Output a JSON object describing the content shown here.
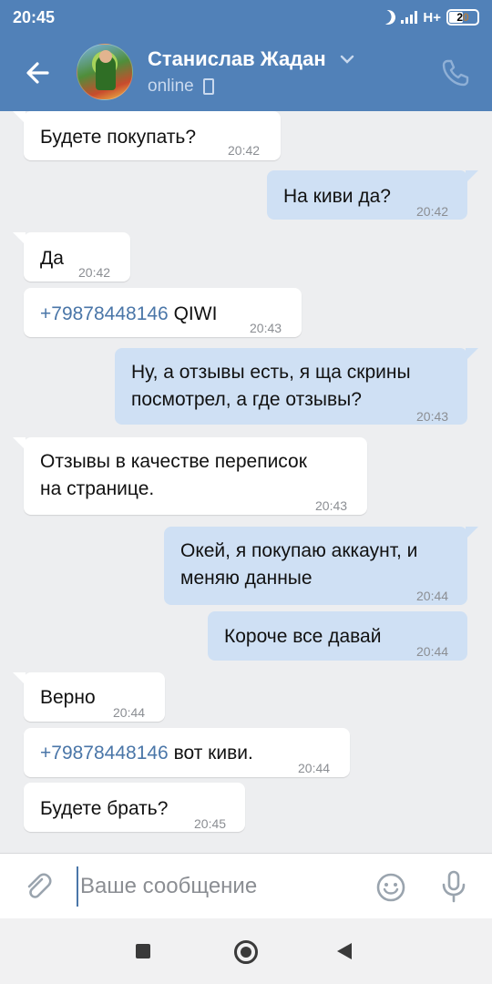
{
  "status_bar": {
    "time": "20:45",
    "network": "H+",
    "battery": "20"
  },
  "header": {
    "contact_name": "Станислав Жадан",
    "status": "online",
    "icons": {
      "back": "arrow-left-icon",
      "chevron": "chevron-down-icon",
      "call": "phone-call-icon",
      "device": "mobile-phone-icon"
    }
  },
  "messages": [
    {
      "dir": "in",
      "lines": [
        "Будете покупать?"
      ],
      "time": "20:42"
    },
    {
      "dir": "out",
      "lines": [
        "На киви да?"
      ],
      "time": "20:42"
    },
    {
      "dir": "in",
      "lines": [
        "Да"
      ],
      "time": "20:42"
    },
    {
      "dir": "in",
      "phone": "+79878448146",
      "after": " QIWI",
      "time": "20:43"
    },
    {
      "dir": "out",
      "lines": [
        "Ну, а отзывы есть, я ща скрины",
        "посмотрел, а где отзывы?"
      ],
      "time": "20:43"
    },
    {
      "dir": "in",
      "lines": [
        "Отзывы в качестве переписок",
        "на странице."
      ],
      "time": "20:43"
    },
    {
      "dir": "out",
      "lines": [
        "Окей, я покупаю аккаунт, и",
        "меняю данные"
      ],
      "time": "20:44"
    },
    {
      "dir": "out",
      "lines": [
        "Короче все давай"
      ],
      "time": "20:44"
    },
    {
      "dir": "in",
      "lines": [
        "Верно"
      ],
      "time": "20:44"
    },
    {
      "dir": "in",
      "phone": "+79878448146",
      "after": " вот киви.",
      "time": "20:44"
    },
    {
      "dir": "in",
      "lines": [
        "Будете брать?"
      ],
      "time": "20:45"
    }
  ],
  "input": {
    "placeholder": "Ваше сообщение",
    "value": ""
  },
  "colors": {
    "header": "#5181b8",
    "outgoing_bubble": "#cfe0f4",
    "incoming_bubble": "#ffffff",
    "link": "#4a76a8",
    "background": "#edeef0"
  }
}
